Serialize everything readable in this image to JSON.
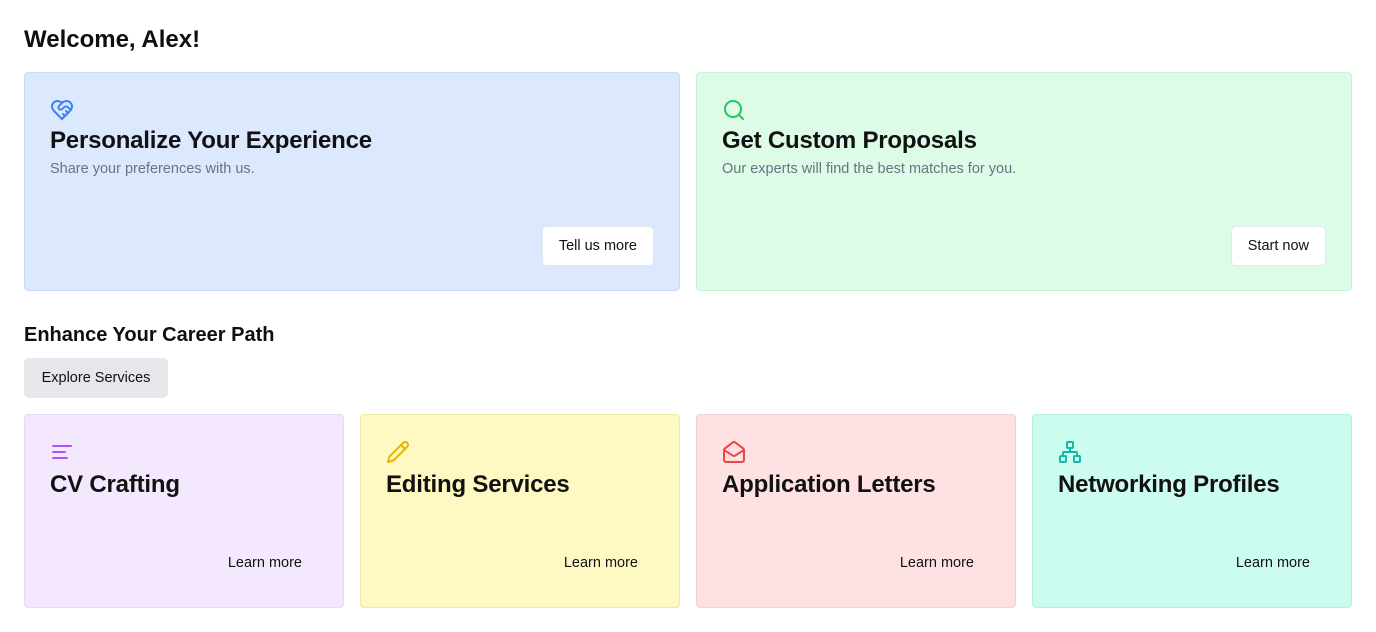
{
  "header": {
    "welcome": "Welcome, Alex!"
  },
  "hero_cards": [
    {
      "icon": "heart-handshake-icon",
      "icon_color": "#3b82f6",
      "title": "Personalize Your Experience",
      "subtitle": "Share your preferences with us.",
      "button": "Tell us more",
      "background": "#dbe8fe"
    },
    {
      "icon": "search-icon",
      "icon_color": "#22c55e",
      "title": "Get Custom Proposals",
      "subtitle": "Our experts will find the best matches for you.",
      "button": "Start now",
      "background": "#dcfce8"
    }
  ],
  "services_section": {
    "title": "Enhance Your Career Path",
    "explore_button": "Explore Services"
  },
  "services": [
    {
      "icon": "align-left-icon",
      "icon_color": "#a855f7",
      "title": "CV Crafting",
      "button": "Learn more",
      "background": "#f3e8fe"
    },
    {
      "icon": "pencil-icon",
      "icon_color": "#eab308",
      "title": "Editing Services",
      "button": "Learn more",
      "background": "#fef8c3"
    },
    {
      "icon": "mail-open-icon",
      "icon_color": "#ef4444",
      "title": "Application Letters",
      "button": "Learn more",
      "background": "#fee2e3"
    },
    {
      "icon": "network-icon",
      "icon_color": "#14b8a6",
      "title": "Networking Profiles",
      "button": "Learn more",
      "background": "#ccfbef"
    }
  ]
}
